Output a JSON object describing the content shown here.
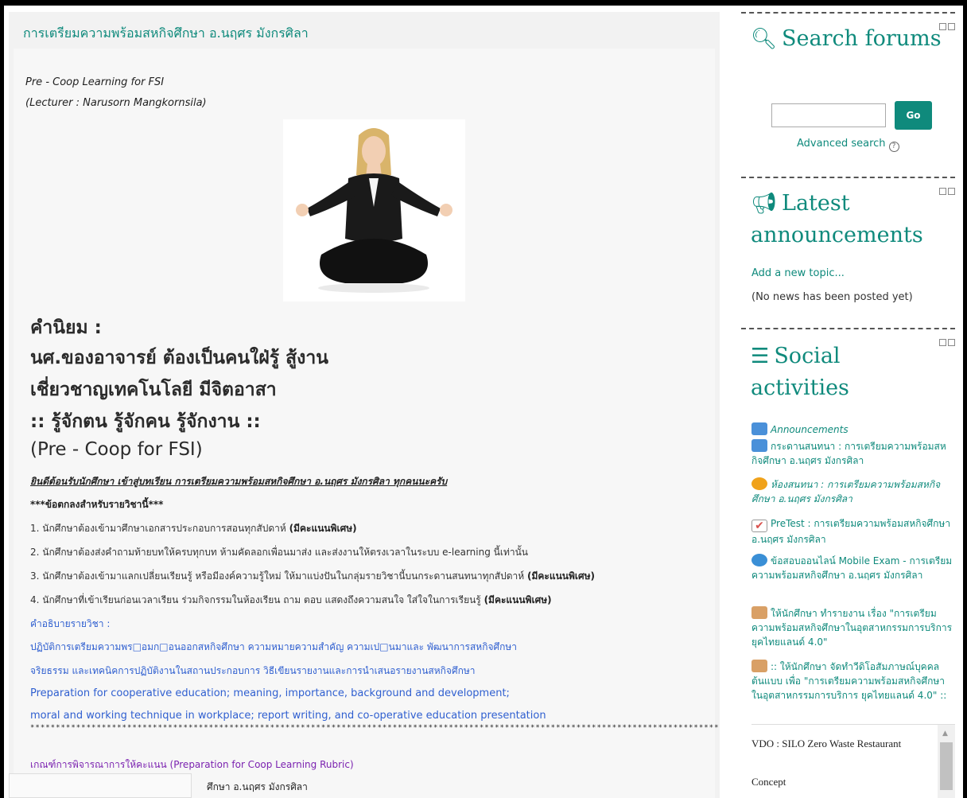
{
  "main": {
    "title": "การเตรียมความพร้อมสหกิจศึกษา อ.นฤศร มังกรศิลา",
    "coop_title": "Pre - Coop Learning for FSI",
    "lecturer": "(Lecturer : Narusorn  Mangkornsila)",
    "motto": [
      "คำนิยม :",
      "นศ.ของอาจารย์ ต้องเป็นคนใฝ่รู้ สู้งาน",
      "เชี่ยวชาญเทคโนโลยี มีจิตอาสา",
      ":: รู้จักตน รู้จักคน รู้จักงาน  ::",
      "(Pre - Coop for FSI)"
    ],
    "welcome": "ยินดีต้อนรับนักศึกษา เข้าสู่บทเรียน การเตรียมความพร้อมสหกิจศึกษา อ.นฤศร มังกรศิลา ทุกคนนะครับ",
    "agreement_heading": "***ข้อตกลงสำหรับรายวิชานี้***",
    "rules": [
      {
        "text": "1. นักศึกษาต้องเข้ามาศึกษาเอกสารประกอบการสอนทุกสัปดาห์ ",
        "bold": "(มีคะแนนพิเศษ)"
      },
      {
        "text": "2. นักศึกษาต้องส่งคำถามท้ายบทให้ครบทุกบท ห้ามคัดลอกเพื่อนมาส่ง และส่งงานให้ตรงเวลาในระบบ e-learning นี้เท่านั้น",
        "bold": ""
      },
      {
        "text": "3. นักศึกษาต้องเข้ามาแลกเปลี่ยนเรียนรู้ หรือมีองค์ความรู้ใหม่ ให้มาแบ่งปันในกลุ่มรายวิชานี้บนกระดานสนทนาทุกสัปดาห์ ",
        "bold": "(มีคะแนนพิเศษ)"
      },
      {
        "text": "4. นักศึกษาที่เข้าเรียนก่อนเวลาเรียน ร่วมกิจกรรมในห้องเรียน ถาม ตอบ แสดงถึงความสนใจ ใส่ใจในการเรียนรู้ ",
        "bold": "(มีคะแนนพิเศษ)"
      }
    ],
    "description_label": "คำอธิบายรายวิชา :",
    "description_lines": [
      "ปฏิบัติการเตรียมความพร□อมก□อนออกสหกิจศึกษา ความหมายความสำคัญ ความเป□นมาและ พัฒนาการสหกิจศึกษา",
      "จริยธรรม และเทคนิคการปฏิบัติงานในสถานประกอบการ วิธีเขียนรายงานและการนำเสนอรายงานสหกิจศึกษา",
      "Preparation for cooperative education; meaning, importance, background and development;",
      "moral and working technique in workplace; report writing, and co-operative education presentation"
    ],
    "stars": "*************************************************************************************************************************************************",
    "rubric_link": "เกณฑ์การพิจารณาการให้คะแนน (Preparation for Coop Learning Rubric)",
    "partial_line": "ศึกษา อ.นฤศร  มังกรศิลา"
  },
  "sidebar": {
    "search": {
      "title": "Search forums",
      "go_label": "Go",
      "advanced": "Advanced search",
      "help": "?"
    },
    "announcements": {
      "title": "Latest announcements",
      "add_topic": "Add a new topic...",
      "no_news": "(No news has been posted yet)"
    },
    "social": {
      "title": "Social activities",
      "items": [
        {
          "text": "Announcements",
          "icon": "forum-icon"
        },
        {
          "text": "กระดานสนทนา : การเตรียมความพร้อมสหกิจศึกษา อ.นฤศร มังกรศิลา",
          "icon": "forum-icon"
        },
        {
          "text": "ห้องสนทนา : การเตรียมความพร้อมสหกิจศึกษา อ.นฤศร มังกรศิลา",
          "icon": "chat-icon"
        },
        {
          "text": "PreTest : การเตรียมความพร้อมสหกิจศึกษา อ.นฤศร มังกรศิลา",
          "icon": "quiz-icon"
        },
        {
          "text": "ข้อสอบออนไลน์ Mobile Exam - การเตรียมความพร้อมสหกิจศึกษา อ.นฤศร มังกรศิลา",
          "icon": "globe-icon"
        },
        {
          "text": "ให้นักศึกษา ทำรายงาน เรื่อง \"การเตรียมความพร้อมสหกิจศึกษาในอุตสาหกรรมการบริการ ยุคไทยแลนด์ 4.0\"",
          "icon": "assignment-icon"
        },
        {
          "text": ":: ให้นักศึกษา จัดทำวีดิโอสัมภาษณ์บุคคลต้นแบบ เพื่อ \"การเตรียมความพร้อมสหกิจศึกษาในอุตสาหกรรมการบริการ ยุคไทยแลนด์ 4.0\" ::",
          "icon": "assignment-icon"
        }
      ],
      "scroll_items": [
        "VDO :  SILO Zero Waste Restaurant",
        "Concept"
      ]
    }
  },
  "colors": {
    "accent": "#0f8a7c",
    "link_blue": "#2f5fd0",
    "purple": "#7b22b0"
  }
}
